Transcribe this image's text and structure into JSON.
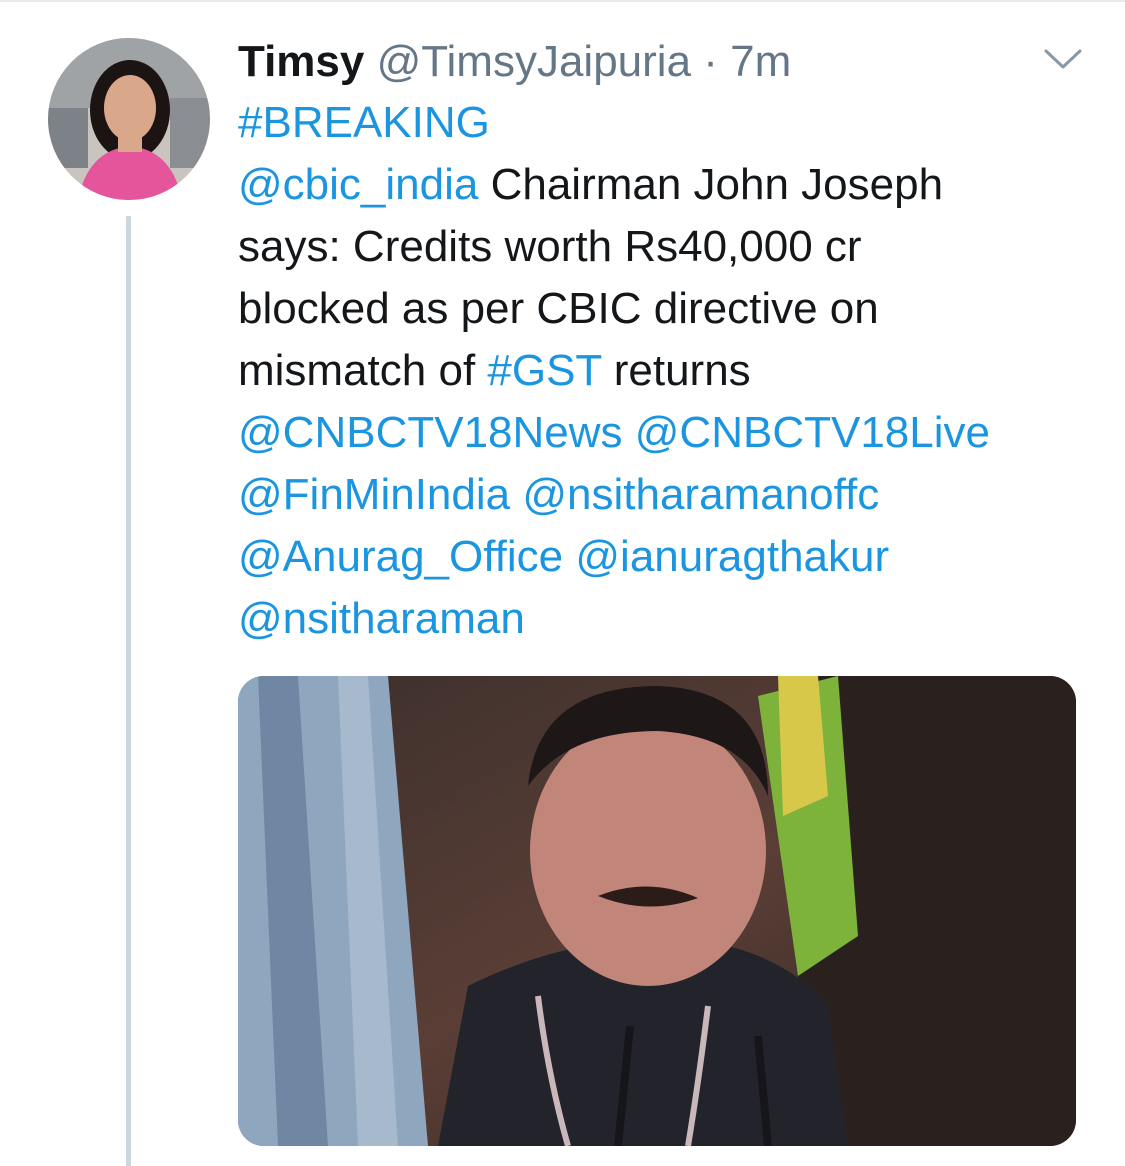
{
  "tweet": {
    "display_name": "Timsy",
    "handle": "@TimsyJaipuria",
    "separator": "·",
    "time": "7m",
    "lines": [
      [
        {
          "text": "#BREAKING",
          "link": true
        }
      ],
      [
        {
          "text": "@cbic_india",
          "link": true
        },
        {
          "text": " Chairman John Joseph",
          "link": false
        }
      ],
      [
        {
          "text": "says: Credits worth Rs40,000 cr",
          "link": false
        }
      ],
      [
        {
          "text": "blocked as per CBIC directive on",
          "link": false
        }
      ],
      [
        {
          "text": "mismatch of ",
          "link": false
        },
        {
          "text": "#GST",
          "link": true
        },
        {
          "text": " returns",
          "link": false
        }
      ],
      [
        {
          "text": "@CNBCTV18News",
          "link": true
        },
        {
          "text": " ",
          "link": false
        },
        {
          "text": "@CNBCTV18Live",
          "link": true
        }
      ],
      [
        {
          "text": "@FinMinIndia",
          "link": true
        },
        {
          "text": " ",
          "link": false
        },
        {
          "text": "@nsitharamanoffc",
          "link": true
        }
      ],
      [
        {
          "text": "@Anurag_Office",
          "link": true
        },
        {
          "text": " ",
          "link": false
        },
        {
          "text": "@ianuragthakur",
          "link": true
        }
      ],
      [
        {
          "text": "@nsitharaman",
          "link": true
        }
      ]
    ]
  },
  "icons": {
    "menu": "chevron-down-icon",
    "avatar": "profile-photo",
    "media": "news-photo"
  },
  "colors": {
    "link": "#1b95e0",
    "text": "#14171a",
    "muted": "#657786",
    "thread_line": "#ccd6dd"
  }
}
